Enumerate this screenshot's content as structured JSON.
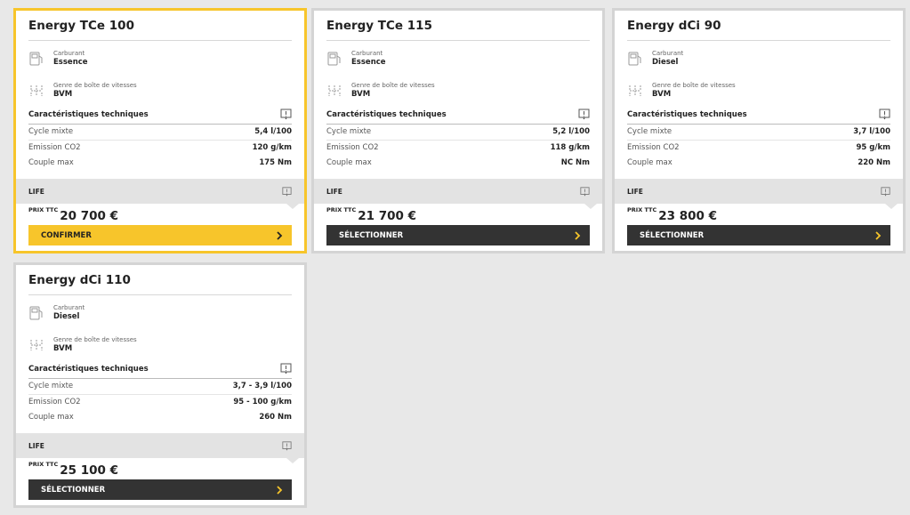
{
  "common": {
    "fuel_label": "Carburant",
    "gearbox_label": "Genre de boîte de vitesses",
    "tech_title": "Caractéristiques techniques",
    "row_labels": [
      "Cycle mixte",
      "Emission CO2",
      "Couple max"
    ],
    "price_label": "PRIX TTC",
    "version": "LIFE"
  },
  "cards": [
    {
      "name": "Energy TCe 100",
      "fuel": "Essence",
      "gearbox": "BVM",
      "cycle": "5,4 l/100",
      "co2": "120 g/km",
      "torque": "175 Nm",
      "price": "20 700 €",
      "button": "CONFIRMER",
      "selected": true
    },
    {
      "name": "Energy TCe 115",
      "fuel": "Essence",
      "gearbox": "BVM",
      "cycle": "5,2 l/100",
      "co2": "118 g/km",
      "torque": "NC Nm",
      "price": "21 700 €",
      "button": "SÉLECTIONNER",
      "selected": false
    },
    {
      "name": "Energy dCi 90",
      "fuel": "Diesel",
      "gearbox": "BVM",
      "cycle": "3,7 l/100",
      "co2": "95 g/km",
      "torque": "220 Nm",
      "price": "23 800 €",
      "button": "SÉLECTIONNER",
      "selected": false
    },
    {
      "name": "Energy dCi 110",
      "fuel": "Diesel",
      "gearbox": "BVM",
      "cycle": "3,7 - 3,9 l/100",
      "co2": "95 - 100 g/km",
      "torque": "260 Nm",
      "price": "25 100 €",
      "button": "SÉLECTIONNER",
      "selected": false
    }
  ],
  "colors": {
    "accent": "#f7c52b",
    "button_dark": "#333333",
    "page_bg": "#e8e8e8"
  },
  "icons": {
    "fuel": "fuel-pump-icon",
    "gearbox": "gear-shift-icon",
    "info": "info-bubble-icon",
    "chevron": "chevron-right-icon"
  }
}
